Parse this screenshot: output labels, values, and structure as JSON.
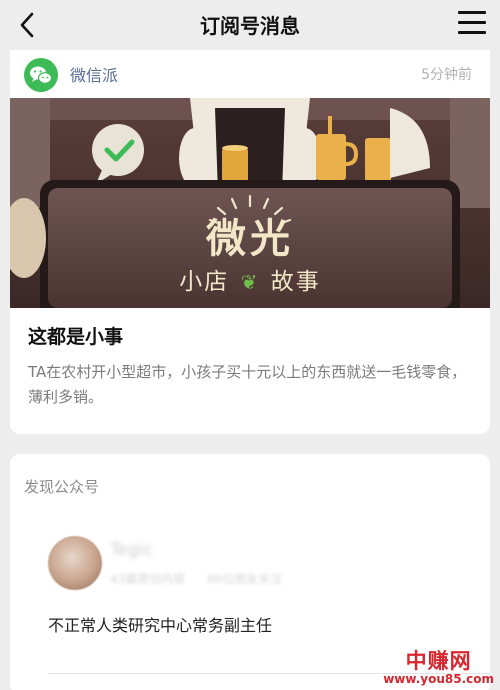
{
  "navbar": {
    "title": "订阅号消息"
  },
  "message": {
    "source_name": "微信派",
    "time": "5分钟前",
    "cover": {
      "headline": "微光",
      "subline_left": "小店",
      "subline_right": "故事"
    },
    "article_title": "这都是小事",
    "article_desc": "TA在农村开小型超市，小孩子买十元以上的东西就送一毛钱零食，薄利多销。"
  },
  "discover": {
    "section_title": "发现公众号",
    "account": {
      "name": "Tegic",
      "stats_articles": "43篇原创内容",
      "stats_friends": "66位朋友关注",
      "bio": "不正常人类研究中心常务副主任"
    }
  },
  "watermark": {
    "cn": "中赚网",
    "url": "www.you85.com"
  },
  "colors": {
    "brand_green": "#3dbb56",
    "link_blue": "#576b95",
    "watermark_red": "#d8262f"
  }
}
